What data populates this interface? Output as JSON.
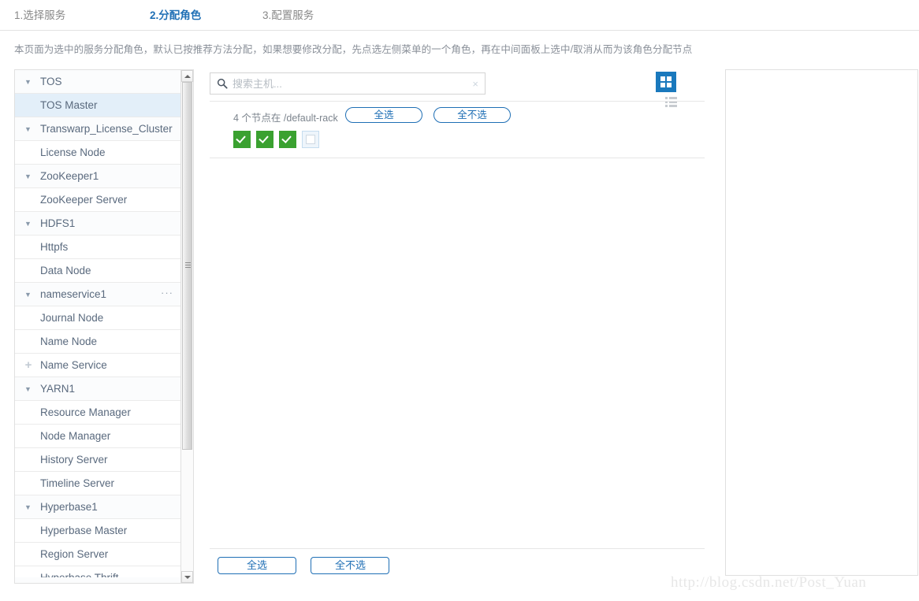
{
  "steps": [
    {
      "label": "1.选择服务",
      "active": false
    },
    {
      "label": "2.分配角色",
      "active": true
    },
    {
      "label": "3.配置服务",
      "active": false
    }
  ],
  "page": {
    "description": "本页面为选中的服务分配角色，默认已按推荐方法分配，如果想要修改分配，先点选左侧菜单的一个角色，再在中间面板上选中/取消从而为该角色分配节点"
  },
  "tree": {
    "items": [
      {
        "label": "TOS",
        "type": "group",
        "expanded": true,
        "selected": false
      },
      {
        "label": "TOS Master",
        "type": "leaf",
        "selected": true
      },
      {
        "label": "Transwarp_License_Cluster",
        "type": "group",
        "expanded": true,
        "selected": false
      },
      {
        "label": "License Node",
        "type": "leaf",
        "selected": false
      },
      {
        "label": "ZooKeeper1",
        "type": "group",
        "expanded": true,
        "selected": false
      },
      {
        "label": "ZooKeeper Server",
        "type": "leaf",
        "selected": false
      },
      {
        "label": "HDFS1",
        "type": "group",
        "expanded": true,
        "selected": false
      },
      {
        "label": "Httpfs",
        "type": "leaf",
        "selected": false
      },
      {
        "label": "Data Node",
        "type": "leaf",
        "selected": false
      },
      {
        "label": "nameservice1",
        "type": "group",
        "expanded": true,
        "selected": false,
        "menu": "···"
      },
      {
        "label": "Journal Node",
        "type": "leaf",
        "selected": false
      },
      {
        "label": "Name Node",
        "type": "leaf",
        "selected": false
      },
      {
        "label": "Name Service",
        "type": "leaf",
        "selected": false,
        "add": true
      },
      {
        "label": "YARN1",
        "type": "group",
        "expanded": true,
        "selected": false
      },
      {
        "label": "Resource Manager",
        "type": "leaf",
        "selected": false
      },
      {
        "label": "Node Manager",
        "type": "leaf",
        "selected": false
      },
      {
        "label": "History Server",
        "type": "leaf",
        "selected": false
      },
      {
        "label": "Timeline Server",
        "type": "leaf",
        "selected": false
      },
      {
        "label": "Hyperbase1",
        "type": "group",
        "expanded": true,
        "selected": false
      },
      {
        "label": "Hyperbase Master",
        "type": "leaf",
        "selected": false
      },
      {
        "label": "Region Server",
        "type": "leaf",
        "selected": false
      },
      {
        "label": "Hyperbase Thrift",
        "type": "leaf",
        "selected": false,
        "cut": true
      }
    ],
    "caret_expanded": "▼",
    "add_glyph": "+"
  },
  "search": {
    "value": "",
    "placeholder": "搜索主机...",
    "clear_glyph": "×"
  },
  "view_toggle": {
    "grid_active": true,
    "grid_name": "grid-view",
    "list_name": "list-view",
    "active_color": "#1a79bd"
  },
  "rack": {
    "count_text": "4 个节点在",
    "path": "/default-rack",
    "select_all": "全选",
    "select_none": "全不选"
  },
  "nodes": {
    "checked_color": "#3aa130",
    "items": [
      {
        "checked": true
      },
      {
        "checked": true
      },
      {
        "checked": true
      },
      {
        "checked": false
      }
    ]
  },
  "footer": {
    "select_all": "全选",
    "select_none": "全不选"
  },
  "watermark": {
    "text": "http://blog.csdn.net/Post_Yuan"
  }
}
